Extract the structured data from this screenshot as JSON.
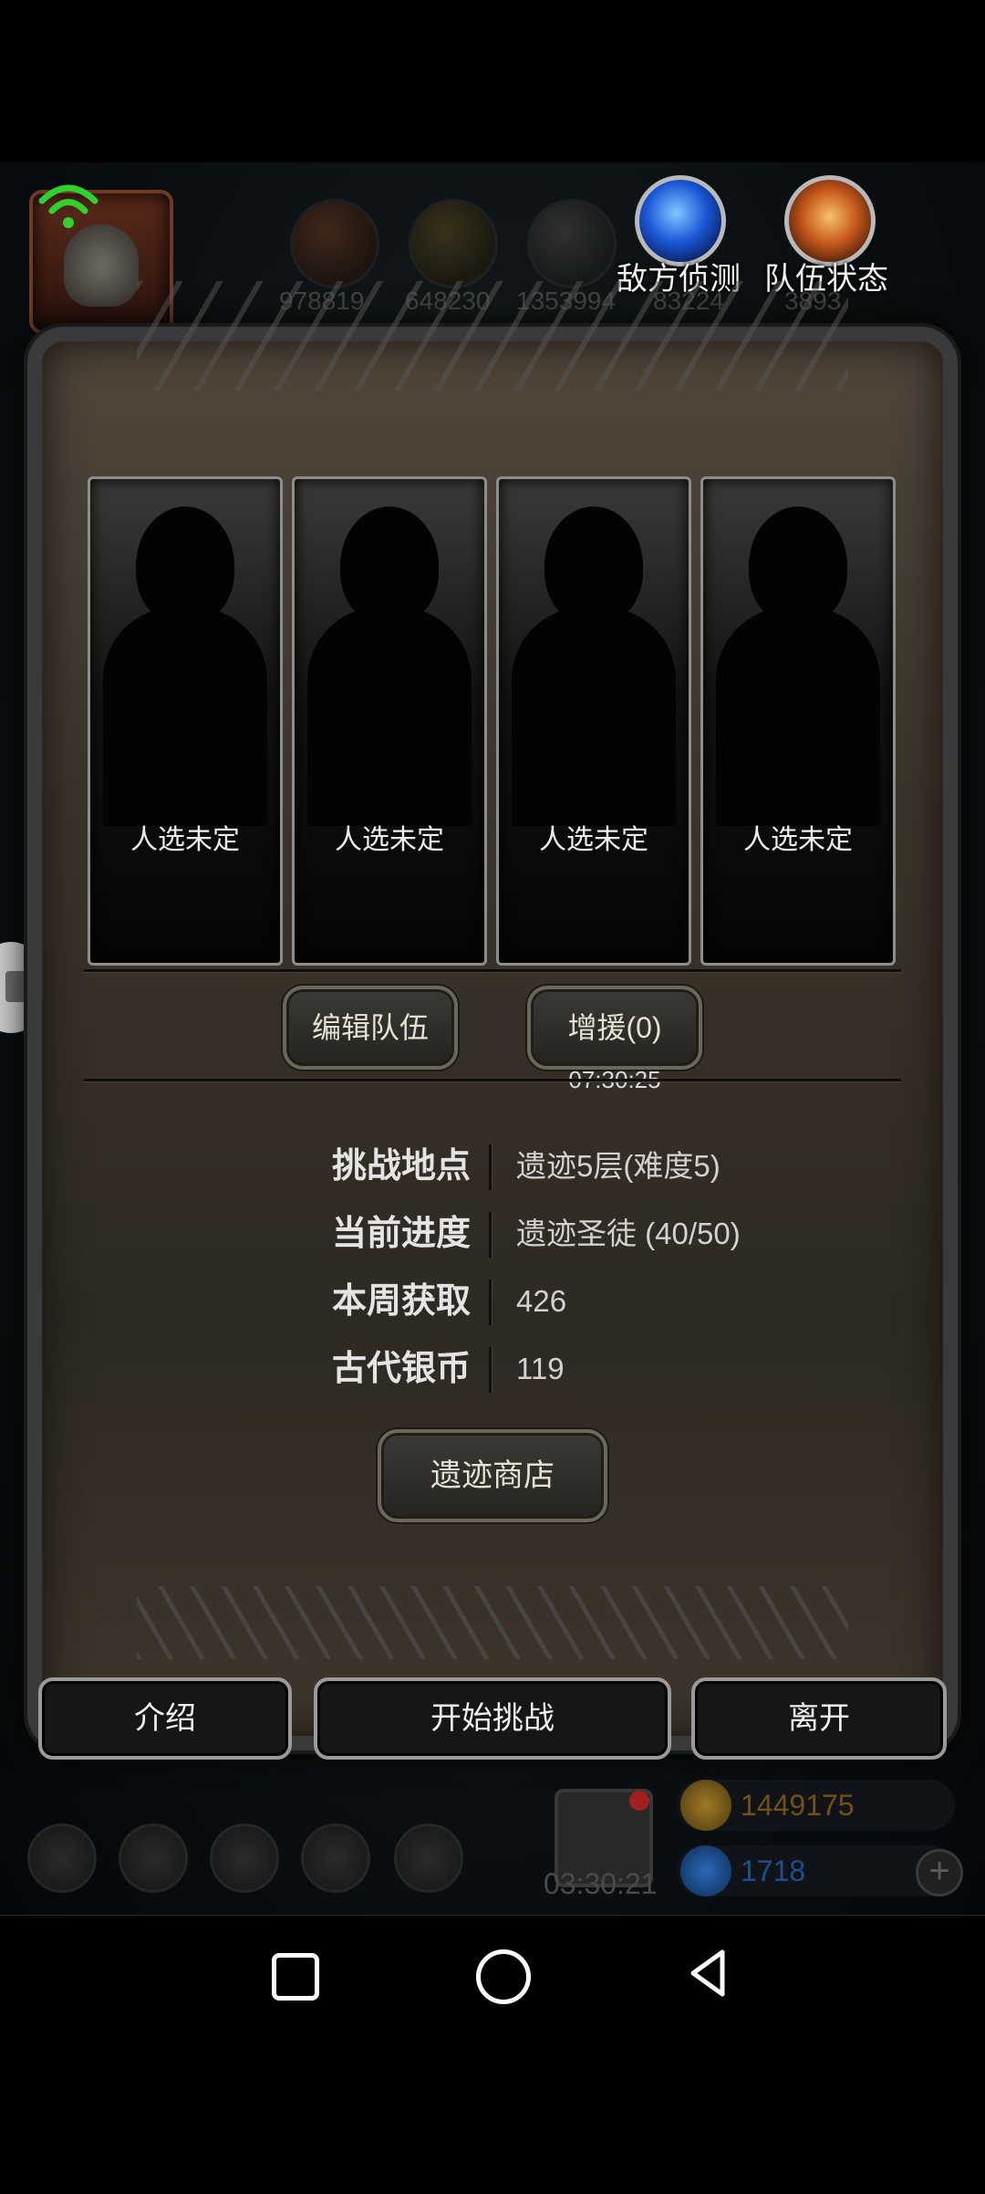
{
  "hud": {
    "resources": [
      "978819",
      "648230",
      "1353994",
      "83224",
      "3893"
    ],
    "enemy_detect_label": "敌方侦测",
    "team_status_label": "队伍状态"
  },
  "slots": [
    {
      "label": "人选未定"
    },
    {
      "label": "人选未定"
    },
    {
      "label": "人选未定"
    },
    {
      "label": "人选未定"
    }
  ],
  "team_actions": {
    "edit_team": "编辑队伍",
    "reinforce": "增援(0)",
    "reinforce_timer": "07:30:25"
  },
  "info": [
    {
      "label": "挑战地点",
      "value": "遗迹5层(难度5)"
    },
    {
      "label": "当前进度",
      "value": "遗迹圣徒 (40/50)"
    },
    {
      "label": "本周获取",
      "value": "426"
    },
    {
      "label": "古代银币",
      "value": "119"
    }
  ],
  "shop_button": "遗迹商店",
  "bottom_actions": {
    "intro": "介绍",
    "start": "开始挑战",
    "leave": "离开"
  },
  "footer": {
    "gift_timer": "03:30:21",
    "gold": "1449175",
    "gems": "1718",
    "gold_color": "#7a5a14",
    "gem_color": "#1d4f8a"
  }
}
